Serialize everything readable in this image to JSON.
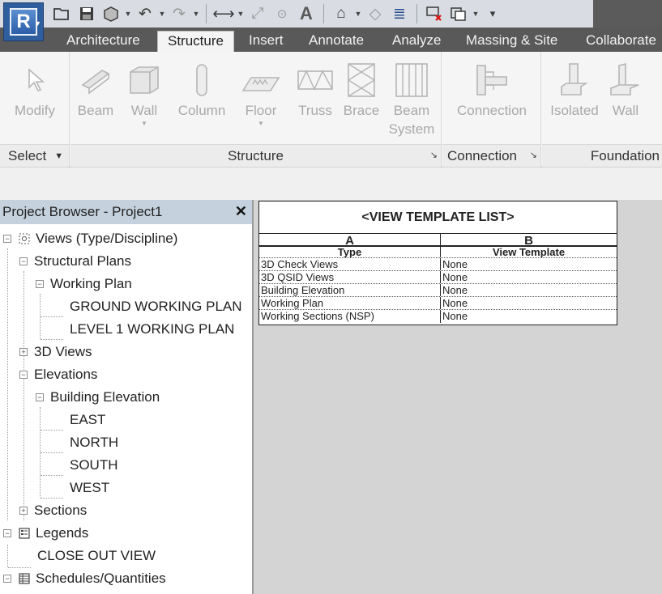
{
  "app": {
    "logo_letter": "R"
  },
  "qat": {
    "tools": [
      "open-icon",
      "save-icon",
      "sync-icon",
      "undo-icon",
      "redo-icon",
      "measure-icon",
      "dimension-icon",
      "tag-icon",
      "text-icon",
      "3d-view-icon",
      "section-icon",
      "thin-lines-icon",
      "close-hidden-icon",
      "switch-windows-icon",
      "customize-icon"
    ]
  },
  "ribbon": {
    "tabs": [
      {
        "label": "Architecture"
      },
      {
        "label": "Structure"
      },
      {
        "label": "Insert"
      },
      {
        "label": "Annotate"
      },
      {
        "label": "Analyze"
      },
      {
        "label": "Massing & Site"
      },
      {
        "label": "Collaborate"
      }
    ],
    "select_panel": {
      "modify": "Modify",
      "title": "Select"
    },
    "structure_panel": {
      "beam": "Beam",
      "wall": "Wall",
      "column": "Column",
      "floor": "Floor",
      "truss": "Truss",
      "brace": "Brace",
      "beam_system_1": "Beam",
      "beam_system_2": "System",
      "title": "Structure"
    },
    "connection_panel": {
      "connection": "Connection",
      "title": "Connection"
    },
    "foundation_panel": {
      "isolated": "Isolated",
      "wall": "Wall",
      "title": "Foundation"
    }
  },
  "browser": {
    "title": "Project Browser - Project1",
    "views": "Views (Type/Discipline)",
    "structural_plans": "Structural Plans",
    "working_plan": "Working Plan",
    "ground_working_plan": "GROUND WORKING PLAN",
    "level1_working_plan": "LEVEL 1 WORKING PLAN",
    "views_3d": "3D Views",
    "elevations": "Elevations",
    "building_elevation": "Building Elevation",
    "east": "EAST",
    "north": "NORTH",
    "south": "SOUTH",
    "west": "WEST",
    "sections": "Sections",
    "legends": "Legends",
    "close_out_view": "CLOSE OUT VIEW",
    "schedules": "Schedules/Quantities"
  },
  "schedule": {
    "title": "<VIEW TEMPLATE LIST>",
    "col_a": "A",
    "col_b": "B",
    "head_a": "Type",
    "head_b": "View Template",
    "rows": [
      {
        "type": "3D Check Views",
        "template": "None"
      },
      {
        "type": "3D QSID Views",
        "template": "None"
      },
      {
        "type": "Building Elevation",
        "template": "None"
      },
      {
        "type": "Working Plan",
        "template": "None"
      },
      {
        "type": "Working Sections (NSP)",
        "template": "None"
      }
    ]
  }
}
